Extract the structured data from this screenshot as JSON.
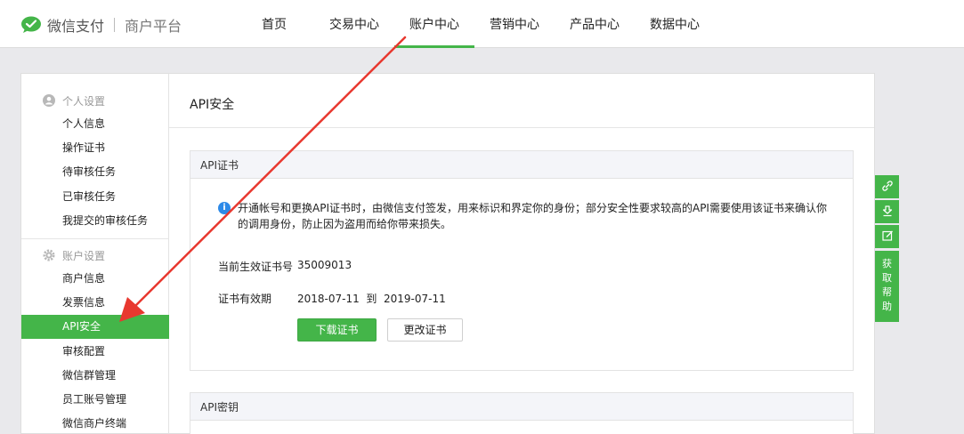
{
  "header": {
    "brand": "微信支付",
    "subtitle": "商户平台",
    "nav": [
      {
        "label": "首页"
      },
      {
        "label": "交易中心"
      },
      {
        "label": "账户中心"
      },
      {
        "label": "营销中心"
      },
      {
        "label": "产品中心"
      },
      {
        "label": "数据中心"
      }
    ],
    "active_nav": "账户中心"
  },
  "sidebar": {
    "personal_heading": "个人设置",
    "personal_items": [
      {
        "label": "个人信息"
      },
      {
        "label": "操作证书"
      },
      {
        "label": "待审核任务"
      },
      {
        "label": "已审核任务"
      },
      {
        "label": "我提交的审核任务"
      }
    ],
    "account_heading": "账户设置",
    "account_items": [
      {
        "label": "商户信息"
      },
      {
        "label": "发票信息"
      },
      {
        "label": "API安全"
      },
      {
        "label": "审核配置"
      },
      {
        "label": "微信群管理"
      },
      {
        "label": "员工账号管理"
      },
      {
        "label": "微信商户终端"
      }
    ],
    "active_item": "API安全"
  },
  "main": {
    "title": "API安全",
    "cert_card": {
      "heading": "API证书",
      "notice": "开通帐号和更换API证书时，由微信支付签发，用来标识和界定你的身份；部分安全性要求较高的API需要使用该证书来确认你的调用身份，防止因为盗用而给你带来损失。",
      "serial_label": "当前生效证书号",
      "serial_value": "35009013",
      "validity_label": "证书有效期",
      "validity_value": "2018-07-11  到  2019-07-11",
      "download_button": "下载证书",
      "change_button": "更改证书"
    },
    "key_card": {
      "heading": "API密钥"
    }
  },
  "float_toolbar": {
    "help_label": [
      "获",
      "取",
      "帮",
      "助"
    ],
    "icons": [
      "link-icon",
      "download-icon",
      "edit-icon"
    ]
  },
  "colors": {
    "accent": "#44b549",
    "annotation": "#e8382f",
    "info": "#2d8ae8"
  }
}
